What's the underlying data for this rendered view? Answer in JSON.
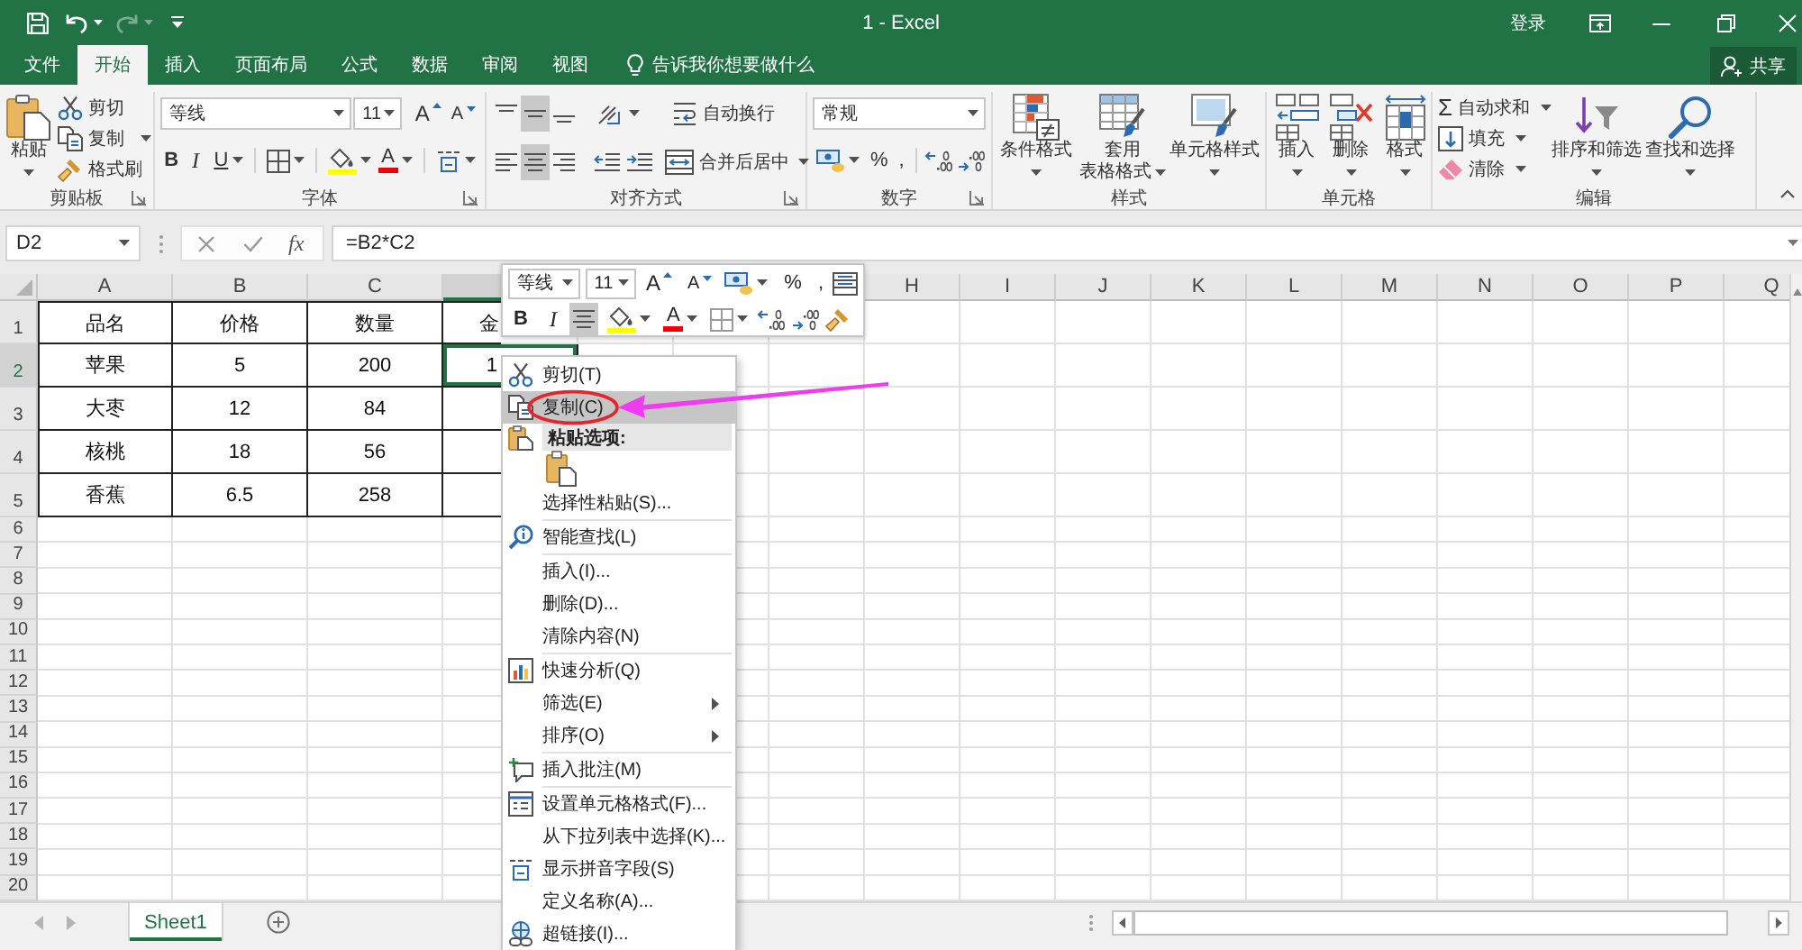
{
  "window": {
    "title": "1 - Excel",
    "sign_in": "登录"
  },
  "quick_access": {
    "redo": {
      "disabled": true
    }
  },
  "tabs": [
    {
      "label": "文件",
      "selected": false
    },
    {
      "label": "开始",
      "selected": true
    },
    {
      "label": "插入",
      "selected": false
    },
    {
      "label": "页面布局",
      "selected": false
    },
    {
      "label": "公式",
      "selected": false
    },
    {
      "label": "数据",
      "selected": false
    },
    {
      "label": "审阅",
      "selected": false
    },
    {
      "label": "视图",
      "selected": false
    }
  ],
  "tell_me": "告诉我你想要做什么",
  "share": "共享",
  "ribbon": {
    "clipboard": {
      "label": "剪贴板",
      "paste": "粘贴",
      "cut": "剪切",
      "copy": "复制",
      "format_painter": "格式刷"
    },
    "font": {
      "label": "字体",
      "name": "等线",
      "size": "11",
      "grow": "A",
      "shrink": "A",
      "bold": "B",
      "italic": "I",
      "underline": "U",
      "font_color": "A"
    },
    "alignment": {
      "label": "对齐方式",
      "vertical": [
        {
          "selected": false
        },
        {
          "selected": true
        },
        {
          "selected": false
        }
      ],
      "horizontal": [
        {
          "selected": false
        },
        {
          "selected": true
        },
        {
          "selected": false
        }
      ],
      "wrap_text": "自动换行",
      "merge_center": "合并后居中"
    },
    "number": {
      "label": "数字",
      "format": "常规",
      "percent": "%",
      "comma": ","
    },
    "styles": {
      "label": "样式",
      "buttons": [
        {
          "lines": [
            "条件格式"
          ]
        },
        {
          "lines": [
            "套用",
            "表格格式"
          ]
        },
        {
          "lines": [
            "单元格样式"
          ]
        }
      ]
    },
    "cells": {
      "label": "单元格",
      "buttons": [
        "插入",
        "删除",
        "格式"
      ]
    },
    "editing": {
      "label": "编辑",
      "autosum_symbol": "Σ",
      "autosum": "自动求和",
      "fill": "填充",
      "clear": "清除",
      "sort_filter": "排序和筛选",
      "find_select": "查找和选择"
    }
  },
  "formula_bar": {
    "name_box": "D2",
    "function_button": "fx",
    "formula": "=B2*C2"
  },
  "sheet": {
    "columns": [
      {
        "label": "A",
        "selected": false
      },
      {
        "label": "B",
        "selected": false
      },
      {
        "label": "C",
        "selected": false
      },
      {
        "selected": true
      },
      {
        "label": "H",
        "selected": false
      },
      {
        "label": "I",
        "selected": false
      },
      {
        "label": "J",
        "selected": false
      },
      {
        "label": "K",
        "selected": false
      },
      {
        "label": "L",
        "selected": false
      },
      {
        "label": "M",
        "selected": false
      },
      {
        "label": "N",
        "selected": false
      },
      {
        "label": "O",
        "selected": false
      },
      {
        "label": "P",
        "selected": false
      },
      {
        "label": "Q",
        "selected": false
      }
    ],
    "rows": [
      {
        "label": "1",
        "selected": false
      },
      {
        "label": "2",
        "selected": true
      },
      {
        "label": "3",
        "selected": false
      },
      {
        "label": "4",
        "selected": false
      },
      {
        "label": "5",
        "selected": false
      },
      {
        "label": "6",
        "selected": false
      },
      {
        "label": "7",
        "selected": false
      },
      {
        "label": "8",
        "selected": false
      },
      {
        "label": "9",
        "selected": false
      },
      {
        "label": "10",
        "selected": false
      },
      {
        "label": "11",
        "selected": false
      },
      {
        "label": "12",
        "selected": false
      },
      {
        "label": "13",
        "selected": false
      },
      {
        "label": "14",
        "selected": false
      },
      {
        "label": "15",
        "selected": false
      },
      {
        "label": "16",
        "selected": false
      },
      {
        "label": "17",
        "selected": false
      },
      {
        "label": "18",
        "selected": false
      },
      {
        "label": "19",
        "selected": false
      },
      {
        "label": "20",
        "selected": false
      }
    ],
    "cells": [
      [
        {
          "text": "品名",
          "selected": false
        },
        {
          "text": "价格",
          "selected": false
        },
        {
          "text": "数量",
          "selected": false
        },
        {
          "text": "金",
          "selected": false
        }
      ],
      [
        {
          "text": "苹果",
          "selected": false
        },
        {
          "text": "5",
          "selected": false
        },
        {
          "text": "200",
          "selected": false
        },
        {
          "text": "1",
          "selected": true
        }
      ],
      [
        {
          "text": "大枣",
          "selected": false
        },
        {
          "text": "12",
          "selected": false
        },
        {
          "text": "84",
          "selected": false
        },
        {
          "selected": false
        }
      ],
      [
        {
          "text": "核桃",
          "selected": false
        },
        {
          "text": "18",
          "selected": false
        },
        {
          "text": "56",
          "selected": false
        },
        {
          "selected": false
        }
      ],
      [
        {
          "text": "香蕉",
          "selected": false
        },
        {
          "text": "6.5",
          "selected": false
        },
        {
          "text": "258",
          "selected": false
        },
        {
          "selected": false
        }
      ]
    ]
  },
  "mini_toolbar": {
    "font_name": "等线",
    "font_size": "11",
    "grow": "A",
    "shrink": "A",
    "percent": "%",
    "comma": ",",
    "bold": "B",
    "italic": "I",
    "center_on": true,
    "font_color": "A"
  },
  "context_menu": [
    {
      "kind": "item",
      "label": "剪切(T)",
      "selected": false,
      "submenu": false
    },
    {
      "kind": "item",
      "label": "复制(C)",
      "selected": true,
      "submenu": false
    },
    {
      "kind": "header",
      "label": "粘贴选项:"
    },
    {
      "kind": "paste_options"
    },
    {
      "kind": "item",
      "label": "选择性粘贴(S)...",
      "selected": false,
      "submenu": false
    },
    {
      "kind": "separator"
    },
    {
      "kind": "item",
      "label": "智能查找(L)",
      "selected": false,
      "submenu": false
    },
    {
      "kind": "separator"
    },
    {
      "kind": "item",
      "label": "插入(I)...",
      "selected": false,
      "submenu": false
    },
    {
      "kind": "item",
      "label": "删除(D)...",
      "selected": false,
      "submenu": false
    },
    {
      "kind": "item",
      "label": "清除内容(N)",
      "selected": false,
      "submenu": false
    },
    {
      "kind": "separator"
    },
    {
      "kind": "item",
      "label": "快速分析(Q)",
      "selected": false,
      "submenu": false
    },
    {
      "kind": "item",
      "label": "筛选(E)",
      "selected": false,
      "submenu": true
    },
    {
      "kind": "item",
      "label": "排序(O)",
      "selected": false,
      "submenu": true
    },
    {
      "kind": "separator"
    },
    {
      "kind": "item",
      "label": "插入批注(M)",
      "selected": false,
      "submenu": false
    },
    {
      "kind": "separator"
    },
    {
      "kind": "item",
      "label": "设置单元格格式(F)...",
      "selected": false,
      "submenu": false
    },
    {
      "kind": "item",
      "label": "从下拉列表中选择(K)...",
      "selected": false,
      "submenu": false
    },
    {
      "kind": "item",
      "label": "显示拼音字段(S)",
      "selected": false,
      "submenu": false
    },
    {
      "kind": "item",
      "label": "定义名称(A)...",
      "selected": false,
      "submenu": false
    },
    {
      "kind": "item",
      "label": "超链接(I)...",
      "selected": false,
      "submenu": false
    }
  ],
  "sheet_nav": [
    {
      "disabled": true
    },
    {
      "disabled": true
    }
  ],
  "sheet_tabs": [
    {
      "label": "Sheet1",
      "selected": true
    }
  ]
}
